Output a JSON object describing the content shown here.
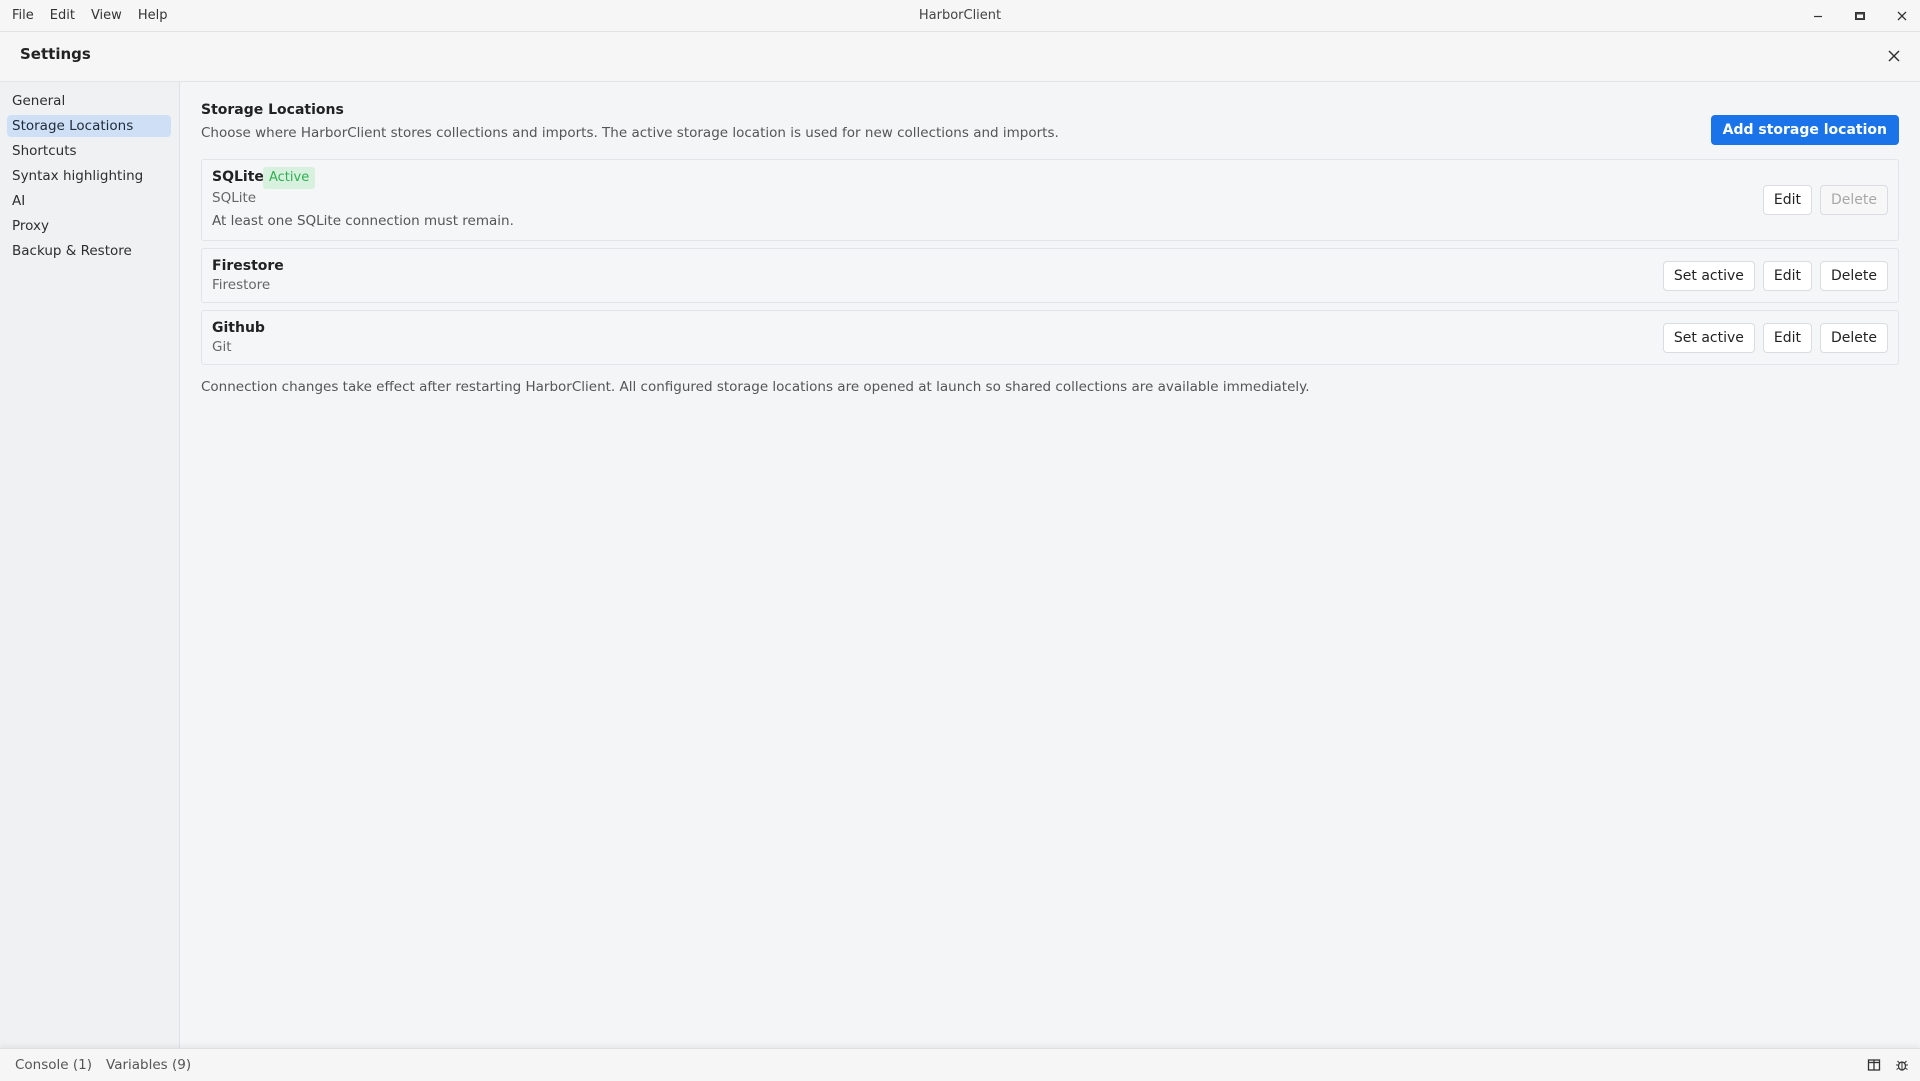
{
  "app": {
    "title": "HarborClient"
  },
  "menu": {
    "items": [
      "File",
      "Edit",
      "View",
      "Help"
    ]
  },
  "window": {
    "minimize_icon": "minimize-icon",
    "maximize_icon": "maximize-icon",
    "close_icon": "close-icon"
  },
  "settings": {
    "title": "Settings",
    "nav": [
      {
        "label": "General",
        "active": false
      },
      {
        "label": "Storage Locations",
        "active": true
      },
      {
        "label": "Shortcuts",
        "active": false
      },
      {
        "label": "Syntax highlighting",
        "active": false
      },
      {
        "label": "AI",
        "active": false
      },
      {
        "label": "Proxy",
        "active": false
      },
      {
        "label": "Backup & Restore",
        "active": false
      }
    ]
  },
  "storage": {
    "title": "Storage Locations",
    "description": "Choose where HarborClient stores collections and imports. The active storage location is used for new collections and imports.",
    "add_button": "Add storage location",
    "locations": [
      {
        "name": "SQLite",
        "badge": "Active",
        "type": "SQLite",
        "note": "At least one SQLite connection must remain.",
        "edit": "Edit",
        "delete": "Delete"
      },
      {
        "name": "Firestore",
        "type": "Firestore",
        "set_active": "Set active",
        "edit": "Edit",
        "delete": "Delete"
      },
      {
        "name": "Github",
        "type": "Git",
        "set_active": "Set active",
        "edit": "Edit",
        "delete": "Delete"
      }
    ],
    "footer_note": "Connection changes take effect after restarting HarborClient. All configured storage locations are opened at launch so shared collections are available immediately."
  },
  "statusbar": {
    "console": "Console (1)",
    "variables": "Variables (9)"
  },
  "colors": {
    "accent": "#1a73e8",
    "active_badge_bg": "#d8f1df",
    "active_badge_text": "#2fae51",
    "nav_active_bg": "#cfe0f6"
  }
}
